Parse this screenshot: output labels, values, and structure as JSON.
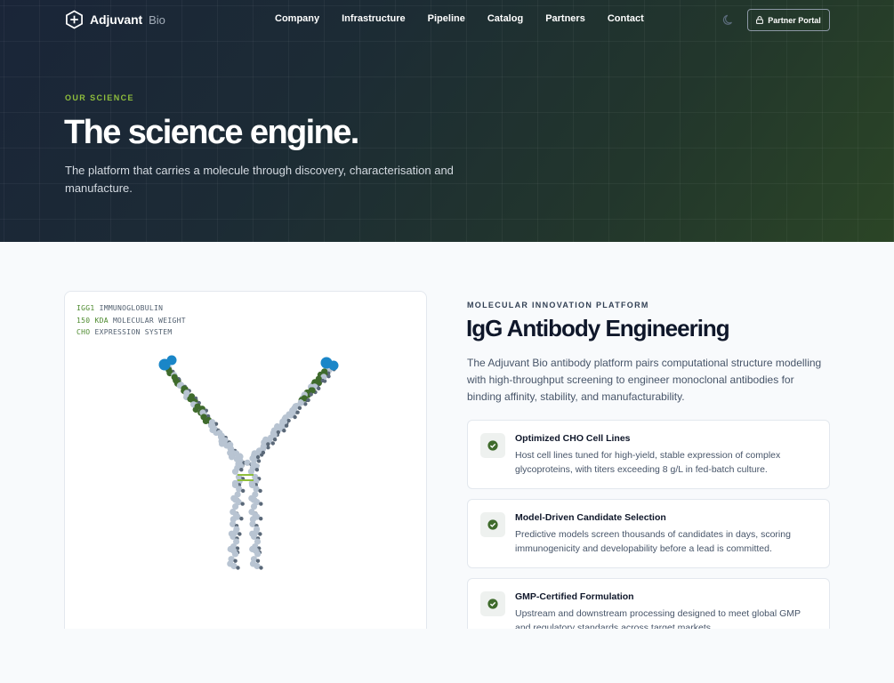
{
  "nav": {
    "brand": "Adjuvant",
    "brand_sub": "Bio",
    "links": [
      "Company",
      "Infrastructure",
      "Pipeline",
      "Catalog",
      "Partners",
      "Contact"
    ],
    "portal_label": "Partner Portal"
  },
  "hero": {
    "eyebrow": "OUR SCIENCE",
    "title": "The science engine.",
    "subtitle": "The platform that carries a molecule through discovery, characterisation and manufacture."
  },
  "viz": {
    "meta": [
      {
        "key": "IGG1",
        "text": " IMMUNOGLOBULIN"
      },
      {
        "key": "150 KDA",
        "text": " MOLECULAR WEIGHT"
      },
      {
        "key": "CHO",
        "text": " EXPRESSION SYSTEM"
      }
    ]
  },
  "section": {
    "eyebrow": "MOLECULAR INNOVATION PLATFORM",
    "title": "IgG Antibody Engineering",
    "description": "The Adjuvant Bio antibody platform pairs computational structure modelling with high-throughput screening to engineer monoclonal antibodies for binding affinity, stability, and manufacturability.",
    "features": [
      {
        "title": "Optimized CHO Cell Lines",
        "description": "Host cell lines tuned for high-yield, stable expression of complex glycoproteins, with titers exceeding 8 g/L in fed-batch culture."
      },
      {
        "title": "Model-Driven Candidate Selection",
        "description": "Predictive models screen thousands of candidates in days, scoring immunogenicity and developability before a lead is committed."
      },
      {
        "title": "GMP-Certified Formulation",
        "description": "Upstream and downstream processing designed to meet global GMP and regulatory standards across target markets."
      }
    ]
  },
  "colors": {
    "accent_green": "#8fbe3c",
    "dark_green": "#3f6b2c",
    "tip_blue": "#1a86c8",
    "chain_gray": "#b8c4d2"
  }
}
